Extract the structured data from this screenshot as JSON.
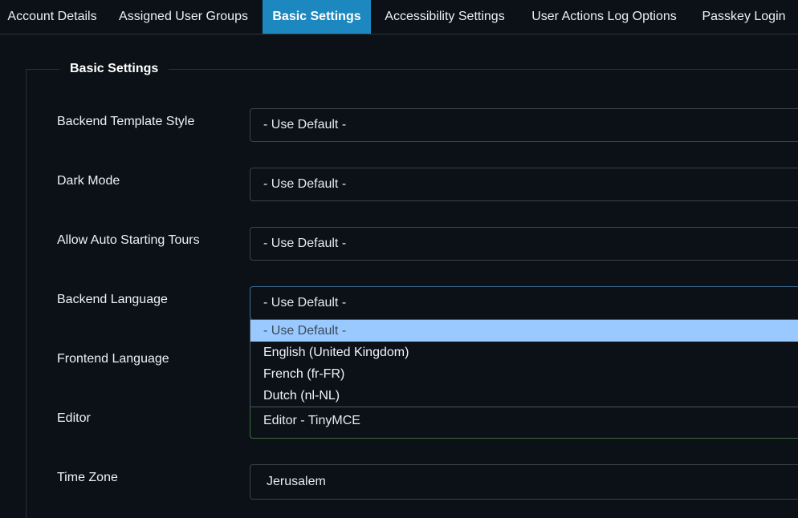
{
  "tabs": [
    {
      "label": "Account Details"
    },
    {
      "label": "Assigned User Groups"
    },
    {
      "label": "Basic Settings",
      "active": true
    },
    {
      "label": "Accessibility Settings"
    },
    {
      "label": "User Actions Log Options"
    },
    {
      "label": "Passkey Login"
    }
  ],
  "fieldset": {
    "legend": "Basic Settings"
  },
  "fields": {
    "backend_template_style": {
      "label": "Backend Template Style",
      "value": "- Use Default -"
    },
    "dark_mode": {
      "label": "Dark Mode",
      "value": "- Use Default -"
    },
    "allow_auto_starting_tours": {
      "label": "Allow Auto Starting Tours",
      "value": "- Use Default -"
    },
    "backend_language": {
      "label": "Backend Language",
      "value": "- Use Default -"
    },
    "frontend_language": {
      "label": "Frontend Language"
    },
    "editor": {
      "label": "Editor",
      "value": "Editor - TinyMCE"
    },
    "time_zone": {
      "label": "Time Zone",
      "value": "Jerusalem"
    }
  },
  "backend_language_dropdown": {
    "options": [
      {
        "label": "- Use Default -",
        "highlighted": true
      },
      {
        "label": "English (United Kingdom)"
      },
      {
        "label": "French (fr-FR)"
      },
      {
        "label": "Dutch (nl-NL)"
      }
    ]
  },
  "colors": {
    "background": "#0c1117",
    "active_tab": "#1d88c0",
    "highlight_option": "#99c9ff"
  }
}
